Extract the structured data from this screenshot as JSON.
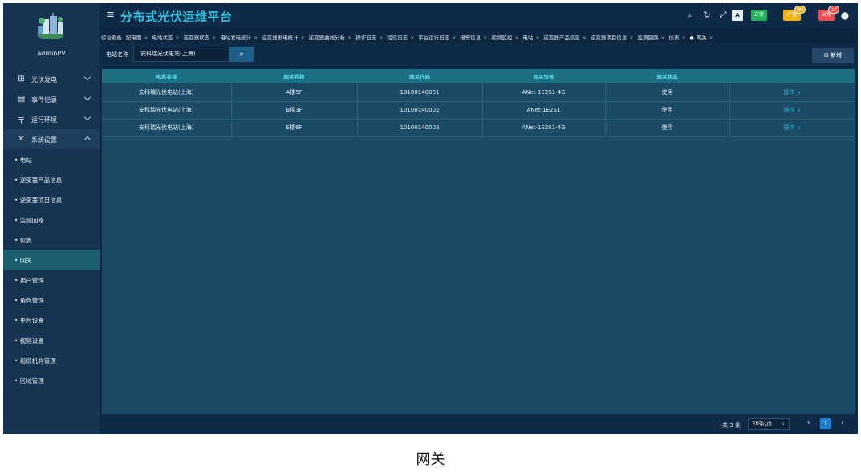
{
  "app": {
    "title": "分布式光伏运维平台",
    "user": "adminPV"
  },
  "header": {
    "btn_blue": "正常",
    "btn_orange": "严重",
    "btn_orange_badge": "99",
    "btn_red": "告警",
    "btn_red_badge": "12"
  },
  "sidebar": {
    "menus": [
      {
        "label": "光伏发电",
        "icon": "grid-icon"
      },
      {
        "label": "事件记录",
        "icon": "document-icon"
      },
      {
        "label": "运行环境",
        "icon": "tower-icon"
      },
      {
        "label": "系统设置",
        "icon": "tools-icon"
      }
    ],
    "subitems": [
      "• 电站",
      "• 逆变器产品信息",
      "• 逆变器项目信息",
      "• 监测回路",
      "• 仪表",
      "• 网关",
      "• 用户管理",
      "• 角色管理",
      "• 平台设置",
      "• 视频设置",
      "• 组织机构管理",
      "• 区域管理"
    ]
  },
  "tabs": [
    {
      "label": "综合看板",
      "closable": false
    },
    {
      "label": "配电图",
      "closable": true
    },
    {
      "label": "电站状态",
      "closable": true
    },
    {
      "label": "逆变器状态",
      "closable": true
    },
    {
      "label": "电站发电统计",
      "closable": true
    },
    {
      "label": "逆变器发电统计",
      "closable": true
    },
    {
      "label": "逆变器曲线分析",
      "closable": true
    },
    {
      "label": "操作日志",
      "closable": true
    },
    {
      "label": "短信日志",
      "closable": true
    },
    {
      "label": "平台运行日志",
      "closable": true
    },
    {
      "label": "报警信息",
      "closable": true
    },
    {
      "label": "视频监控",
      "closable": true
    },
    {
      "label": "电站",
      "closable": true
    },
    {
      "label": "逆变器产品信息",
      "closable": true
    },
    {
      "label": "逆变器项目信息",
      "closable": true
    },
    {
      "label": "监测回路",
      "closable": true
    },
    {
      "label": "仪表",
      "closable": true
    },
    {
      "label": "网关",
      "closable": true
    }
  ],
  "filter": {
    "label": "电站名称",
    "value": "安科瑞光伏电站(上海)"
  },
  "add_label": "新增",
  "table": {
    "headers": [
      "电站名称",
      "网关名称",
      "网关代码",
      "网关型号",
      "网关状态",
      ""
    ],
    "rows": [
      [
        "安科瑞光伏电站(上海)",
        "A楼5F",
        "10100140001",
        "ANet-1E2S1-4G",
        "使用",
        "操作"
      ],
      [
        "安科瑞光伏电站(上海)",
        "B楼3F",
        "10100140002",
        "ANet-1E2S1",
        "使用",
        "操作"
      ],
      [
        "安科瑞光伏电站(上海)",
        "E楼6F",
        "10100140003",
        "ANet-1E2S1-4G",
        "使用",
        "操作"
      ]
    ]
  },
  "footer": {
    "total": "共 3 条",
    "page_size": "20条/页",
    "page": "1"
  },
  "caption": "网关"
}
